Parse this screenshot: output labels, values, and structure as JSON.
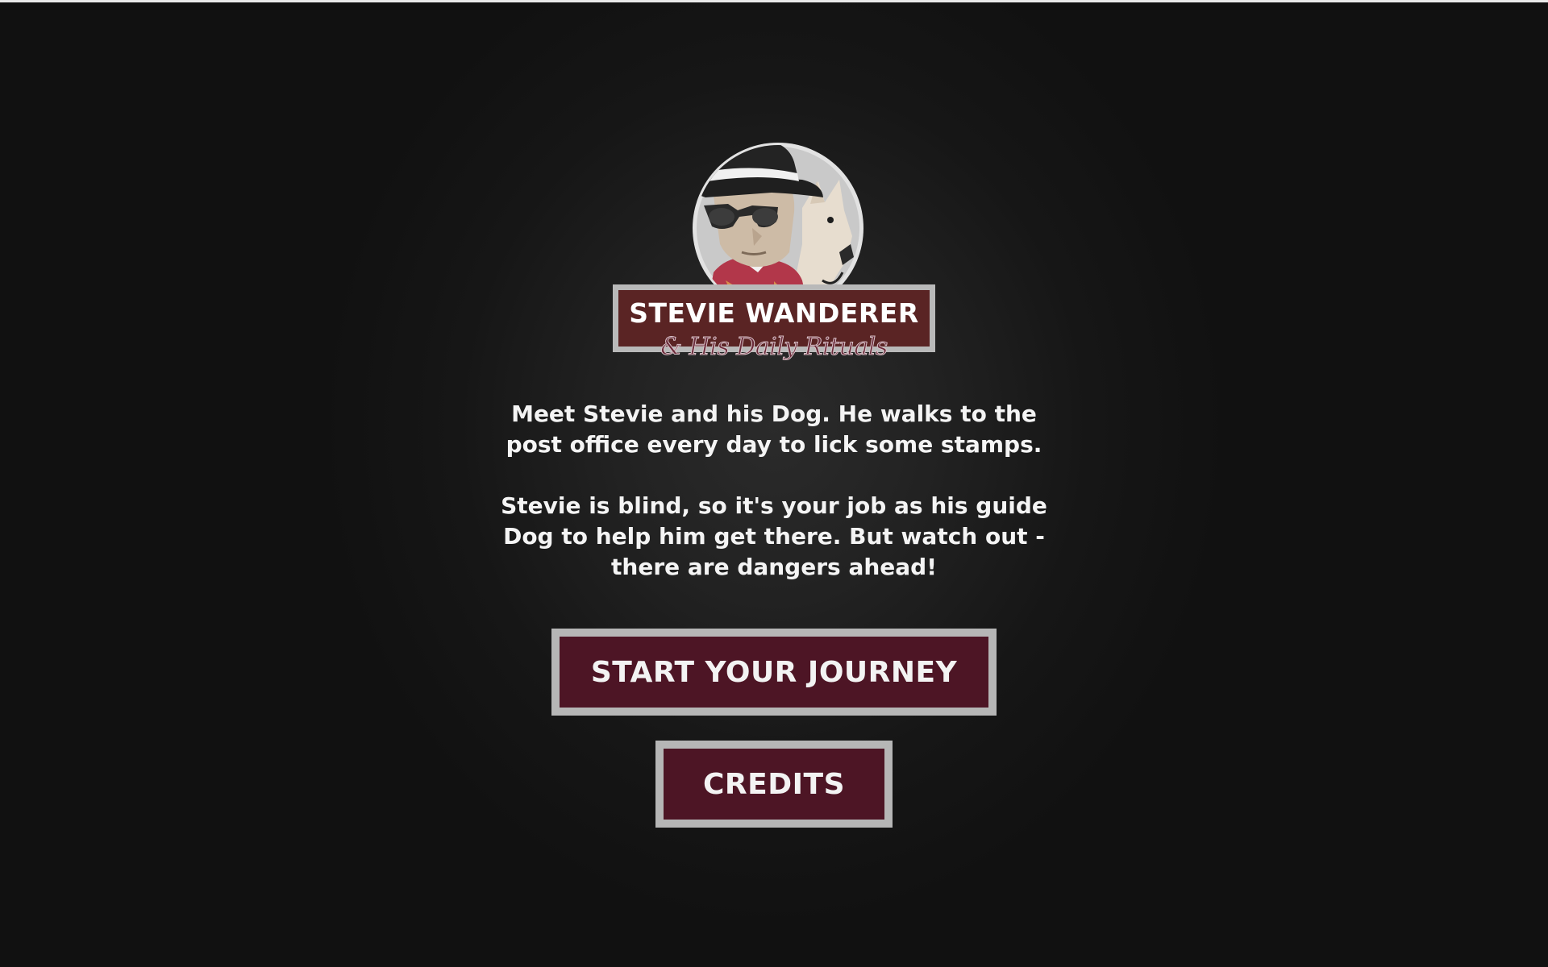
{
  "game": {
    "title": "STEVIE WANDERER",
    "subtitle": "& His Daily Rituals",
    "description": [
      {
        "line1": "Meet Stevie and his Dog. He walks to the",
        "line2": "post office every day to lick some stamps."
      },
      {
        "line1": "Stevie is blind, so it's your job as his guide",
        "line2": "Dog to help him get there. But watch out -",
        "line3": "there are dangers ahead!"
      }
    ]
  },
  "menu": {
    "start_label": "START YOUR JOURNEY",
    "credits_label": "CREDITS"
  },
  "colors": {
    "background": "#111111",
    "plate": "#5a2424",
    "button": "#4d1525",
    "border": "#b6b6b6",
    "text": "#f4f4f4"
  },
  "icons": {
    "portrait": "stevie-and-dog-portrait"
  }
}
